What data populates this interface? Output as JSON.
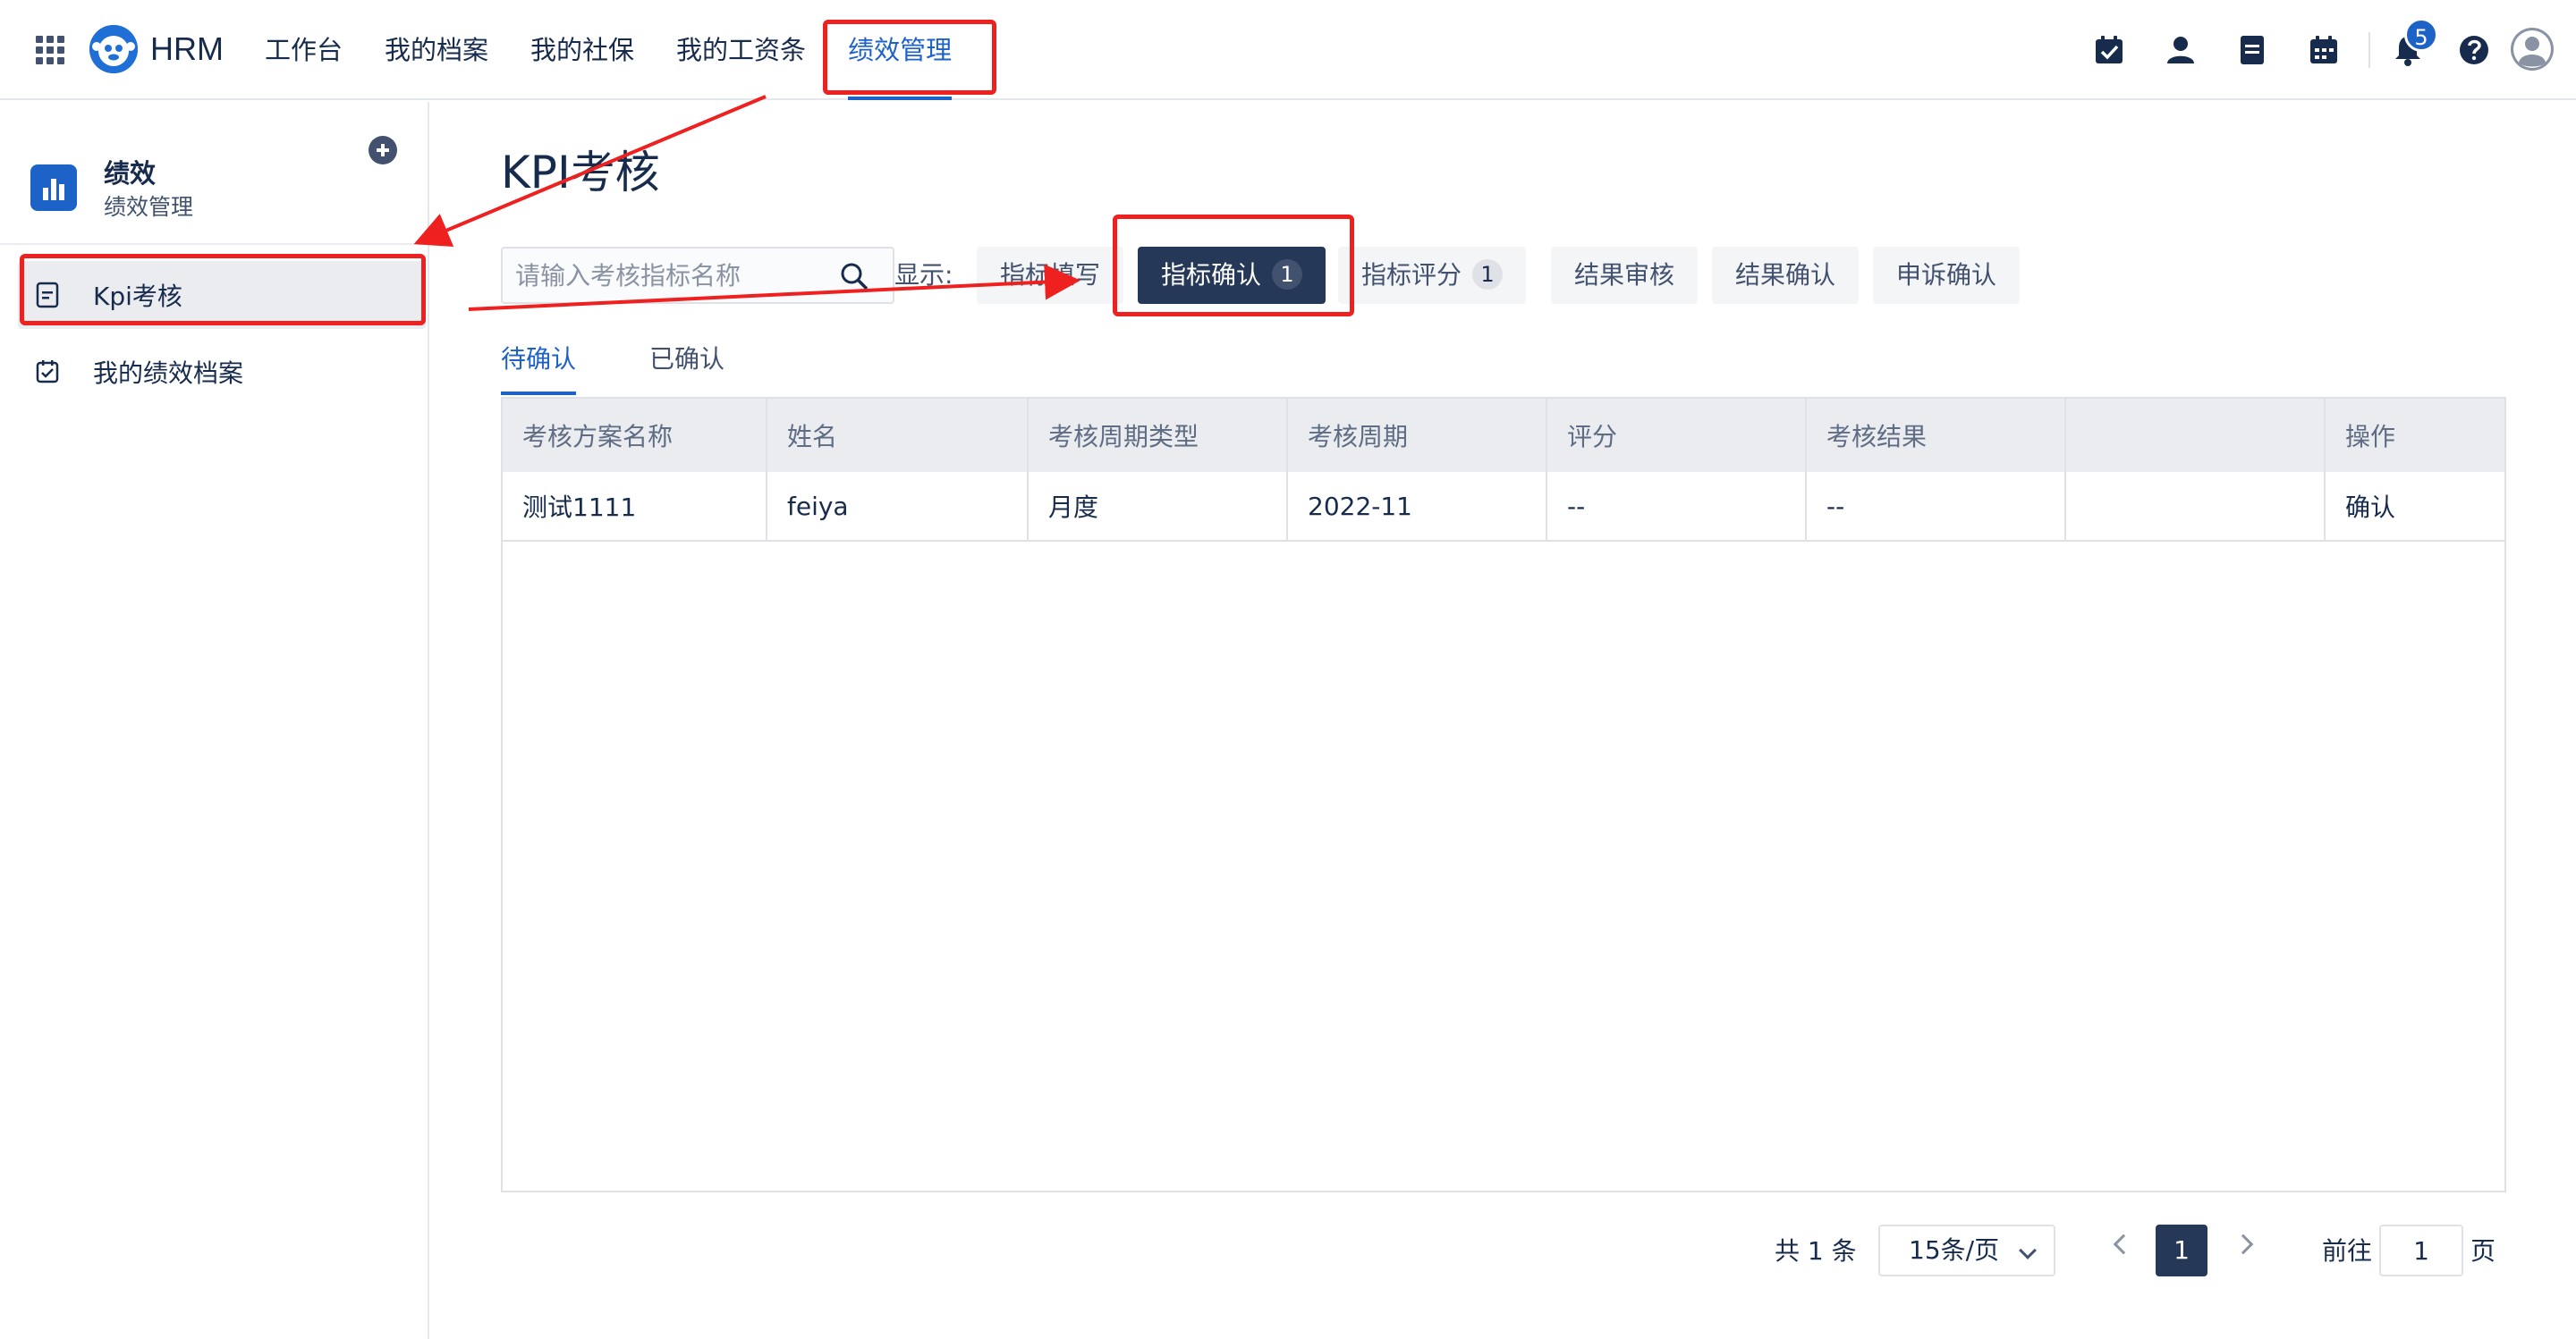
{
  "header": {
    "brand": "HRM",
    "nav": [
      "工作台",
      "我的档案",
      "我的社保",
      "我的工资条",
      "绩效管理"
    ],
    "active_nav": "绩效管理",
    "icons": [
      "calendar-check-icon",
      "user-icon",
      "document-icon",
      "calendar-icon",
      "bell-icon",
      "help-icon",
      "avatar-icon"
    ],
    "notification_count": "5"
  },
  "sidebar": {
    "title": "绩效",
    "subtitle": "绩效管理",
    "items": [
      {
        "label": "Kpi考核",
        "icon": "document-icon",
        "active": true
      },
      {
        "label": "我的绩效档案",
        "icon": "calendar-check-icon",
        "active": false
      }
    ]
  },
  "main": {
    "title": "KPI考核",
    "search": {
      "placeholder": "请输入考核指标名称",
      "value": ""
    },
    "show_label": "显示:",
    "filters": [
      {
        "label": "指标填写",
        "count": ""
      },
      {
        "label": "指标确认",
        "count": "1"
      },
      {
        "label": "指标评分",
        "count": "1"
      },
      {
        "label": "结果审核",
        "count": ""
      },
      {
        "label": "结果确认",
        "count": ""
      },
      {
        "label": "申诉确认",
        "count": ""
      }
    ],
    "active_filter": "指标确认",
    "tabs": [
      "待确认",
      "已确认"
    ],
    "active_tab": "待确认",
    "table": {
      "columns": [
        "考核方案名称",
        "姓名",
        "考核周期类型",
        "考核周期",
        "评分",
        "考核结果",
        "",
        "操作"
      ],
      "rows": [
        [
          "测试1111",
          "feiya",
          "月度",
          "2022-11",
          "--",
          "--",
          "",
          "确认"
        ]
      ]
    },
    "pagination": {
      "total": "共 1 条",
      "page_size": "15条/页",
      "current_page": "1",
      "goto_label": "前往",
      "goto_value": "1",
      "page_suffix": "页"
    }
  },
  "colors": {
    "accent": "#1d62c6",
    "dark_button": "#253858",
    "annotation": "#ee2020"
  }
}
